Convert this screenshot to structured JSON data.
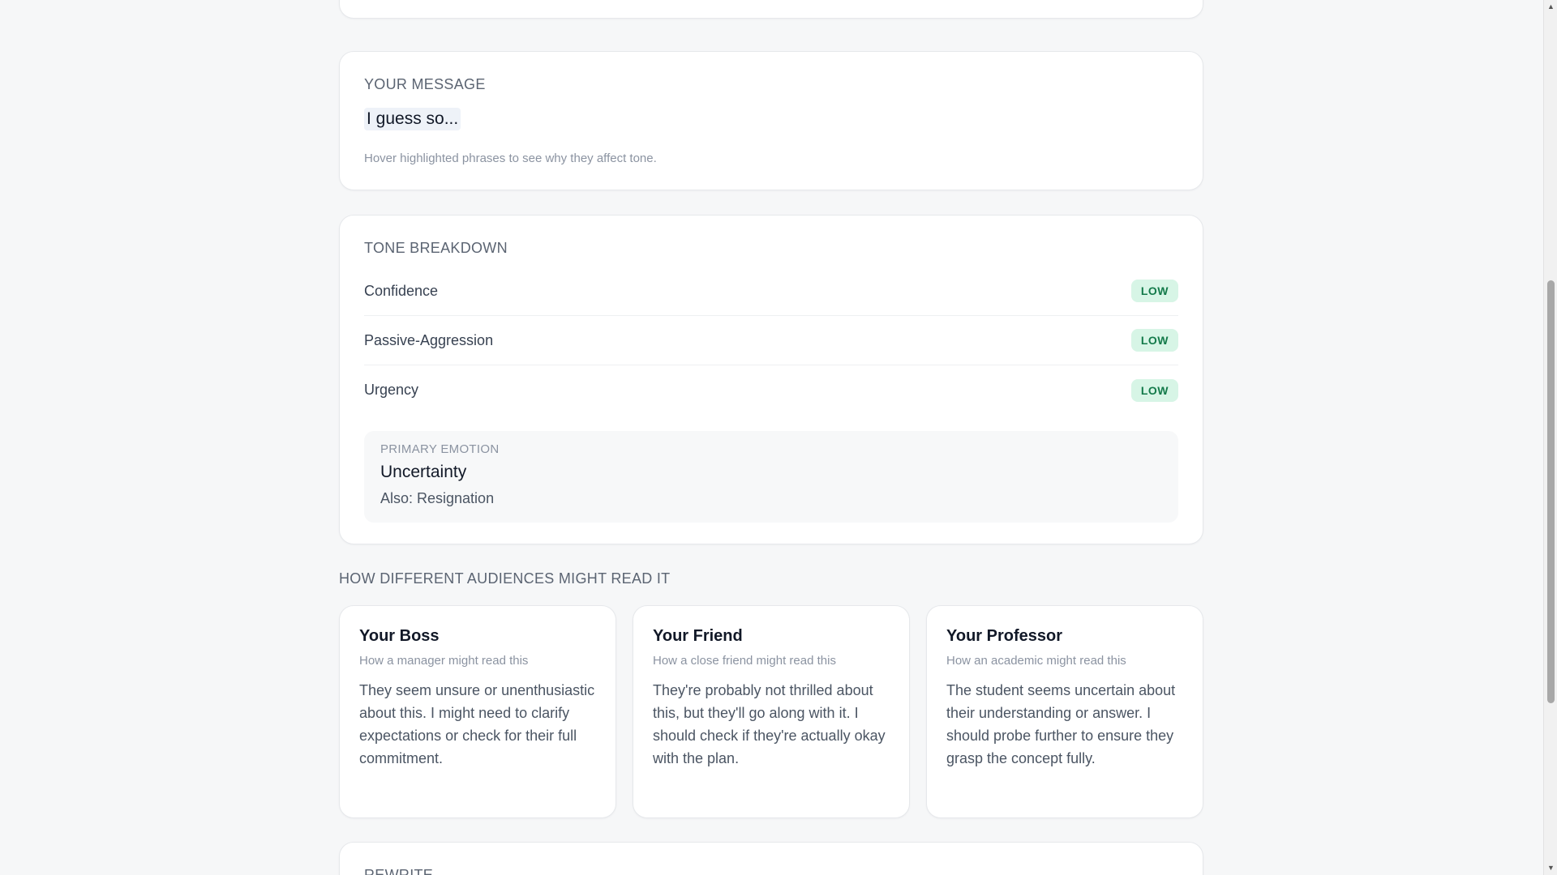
{
  "message_card": {
    "label": "YOUR MESSAGE",
    "text": "I guess so...",
    "hint": "Hover highlighted phrases to see why they affect tone."
  },
  "tone_card": {
    "label": "TONE BREAKDOWN",
    "rows": [
      {
        "name": "Confidence",
        "level": "LOW"
      },
      {
        "name": "Passive-Aggression",
        "level": "LOW"
      },
      {
        "name": "Urgency",
        "level": "LOW"
      }
    ],
    "emotion": {
      "label": "PRIMARY EMOTION",
      "primary": "Uncertainty",
      "also": "Also: Resignation"
    }
  },
  "audiences": {
    "heading": "HOW DIFFERENT AUDIENCES MIGHT READ IT",
    "cards": [
      {
        "title": "Your Boss",
        "subtitle": "How a manager might read this",
        "body": "They seem unsure or unenthusiastic about this. I might need to clarify expectations or check for their full commitment."
      },
      {
        "title": "Your Friend",
        "subtitle": "How a close friend might read this",
        "body": "They're probably not thrilled about this, but they'll go along with it. I should check if they're actually okay with the plan."
      },
      {
        "title": "Your Professor",
        "subtitle": "How an academic might read this",
        "body": "The student seems uncertain about their understanding or answer. I should probe further to ensure they grasp the concept fully."
      }
    ]
  },
  "rewrite_card": {
    "label": "REWRITE"
  },
  "colors": {
    "background": "#f6f7f8",
    "badge_bg": "#d7f5e6",
    "badge_text": "#137a4a",
    "highlight": "#eef2f8"
  }
}
